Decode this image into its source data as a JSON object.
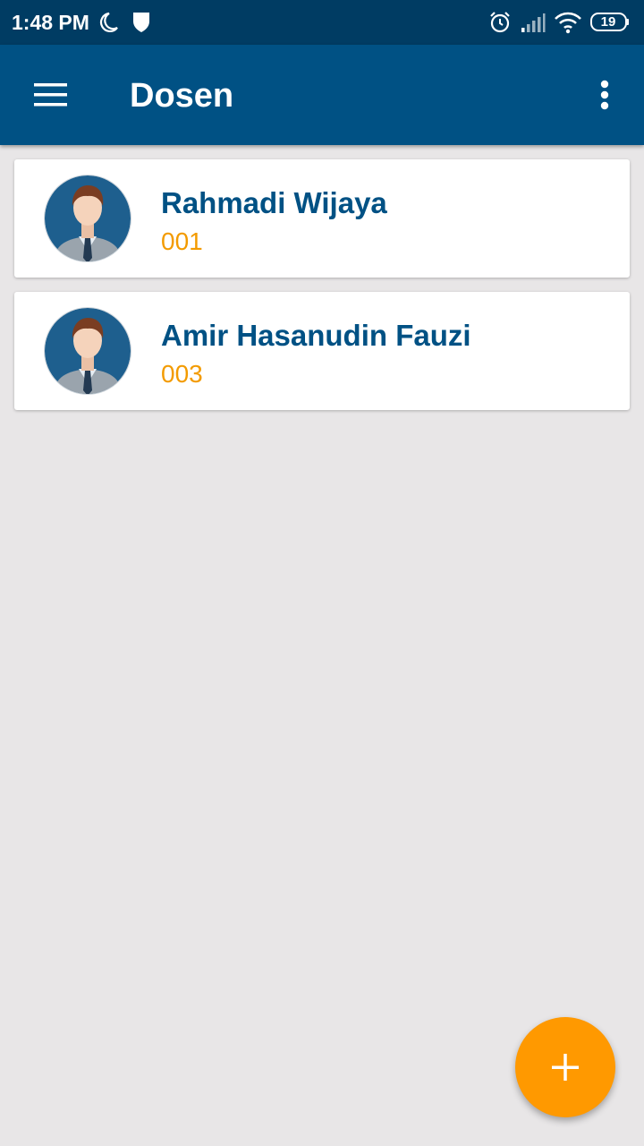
{
  "status_bar": {
    "time": "1:48 PM",
    "battery_level": "19",
    "icons": [
      "moon-icon",
      "shield-icon",
      "alarm-icon",
      "signal-icon",
      "wifi-icon",
      "battery-icon"
    ]
  },
  "app_bar": {
    "title": "Dosen",
    "menu_icon": "hamburger-menu-icon",
    "overflow_icon": "more-vert-icon"
  },
  "dosen_list": [
    {
      "name": "Rahmadi Wijaya",
      "code": "001",
      "avatar": "male-avatar-icon"
    },
    {
      "name": "Amir Hasanudin Fauzi",
      "code": "003",
      "avatar": "male-avatar-icon"
    }
  ],
  "fab": {
    "icon": "plus-icon"
  },
  "colors": {
    "status_bar": "#003c63",
    "app_bar": "#005184",
    "background": "#e8e6e7",
    "name_text": "#005184",
    "code_text": "#f39b00",
    "fab": "#ff9900"
  }
}
